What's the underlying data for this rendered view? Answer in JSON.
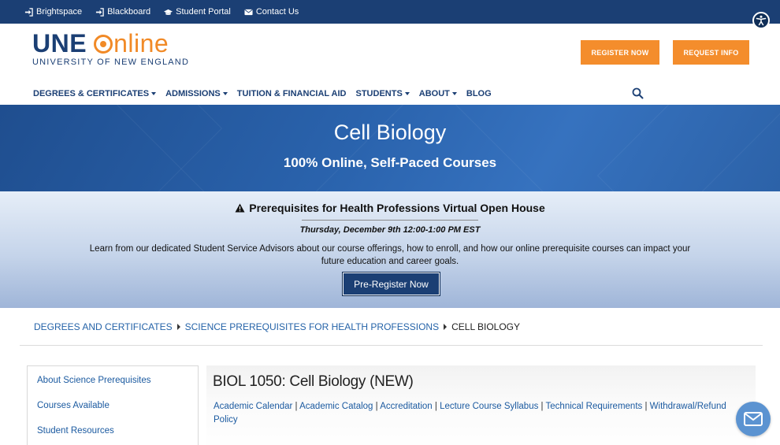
{
  "topbar": {
    "links": [
      {
        "label": "Brightspace",
        "icon": "sign-in-icon"
      },
      {
        "label": "Blackboard",
        "icon": "sign-in-icon"
      },
      {
        "label": "Student Portal",
        "icon": "graduation-cap-icon"
      },
      {
        "label": "Contact Us",
        "icon": "envelope-icon"
      }
    ],
    "accessibility_icon": "accessibility-icon"
  },
  "logo": {
    "une": "UNE",
    "online": "nline",
    "subtitle": "UNIVERSITY OF NEW ENGLAND"
  },
  "header": {
    "register_label": "REGISTER NOW",
    "request_label": "REQUEST INFO"
  },
  "nav": {
    "items": [
      {
        "label": "DEGREES & CERTIFICATES",
        "dropdown": true
      },
      {
        "label": "ADMISSIONS",
        "dropdown": true
      },
      {
        "label": "TUITION & FINANCIAL AID",
        "dropdown": false
      },
      {
        "label": "STUDENTS",
        "dropdown": true
      },
      {
        "label": "ABOUT",
        "dropdown": true
      },
      {
        "label": "BLOG",
        "dropdown": false
      }
    ],
    "search_icon": "search-icon"
  },
  "hero": {
    "title": "Cell Biology",
    "subtitle": "100% Online, Self-Paced Courses"
  },
  "announcement": {
    "title": "Prerequisites for Health Professions Virtual Open House",
    "date": "Thursday, December 9th 12:00-1:00 PM EST",
    "description": "Learn from our dedicated Student Service Advisors about our course offerings, how to enroll, and how our online prerequisite courses can impact your future education and career goals.",
    "button_label": "Pre-Register Now"
  },
  "breadcrumb": {
    "items": [
      "DEGREES AND CERTIFICATES",
      "SCIENCE PREREQUISITES FOR HEALTH PROFESSIONS"
    ],
    "current": "CELL BIOLOGY"
  },
  "sidebar": {
    "items": [
      "About Science Prerequisites",
      "Courses Available",
      "Student Resources"
    ]
  },
  "main": {
    "title": "BIOL 1050: Cell Biology (NEW)",
    "links": [
      "Academic Calendar",
      "Academic Catalog",
      "Accreditation",
      "Lecture Course Syllabus",
      "Technical Requirements",
      "Withdrawal/Refund Policy"
    ],
    "separator": " | "
  },
  "chat": {
    "icon": "chat-envelope-icon"
  },
  "colors": {
    "navy": "#1b3f74",
    "orange": "#f48d2c",
    "link_blue": "#1b5aa0"
  }
}
